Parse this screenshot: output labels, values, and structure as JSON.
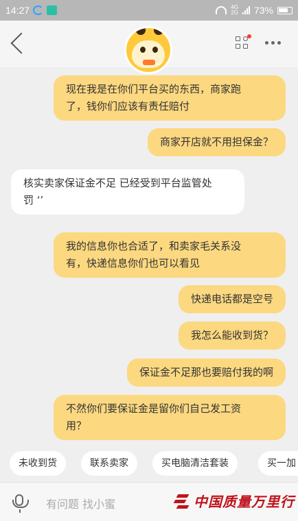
{
  "status_bar": {
    "time": "14:27",
    "network": "4G",
    "network2": "2G",
    "battery": "73%"
  },
  "header": {
    "back_icon": "chevron-left-icon",
    "avatar_icon": "bee-mascot-avatar",
    "menu_icon": "grid-menu-icon",
    "more_icon": "more-dots-icon"
  },
  "messages": [
    {
      "side": "out",
      "lines": [
        "现在我是在你们平台买的东西，商家跑",
        "了，钱你们应该有责任赔付"
      ]
    },
    {
      "side": "out",
      "lines": [
        "商家开店就不用担保金？"
      ]
    },
    {
      "side": "in",
      "lines": [
        "核实卖家保证金不足 已经受到平台监管处",
        "罚 ‘’"
      ]
    },
    {
      "side": "out",
      "lines": [
        "我的信息你也合适了，和卖家毛关系没",
        "有，快递信息你们也可以看见"
      ]
    },
    {
      "side": "out",
      "lines": [
        "快递电话都是空号"
      ]
    },
    {
      "side": "out",
      "lines": [
        "我怎么能收到货？"
      ]
    },
    {
      "side": "out",
      "lines": [
        "保证金不足那也要赔付我的啊"
      ]
    },
    {
      "side": "out",
      "lines": [
        "不然你们要保证金是留你们自己发工资",
        "用？"
      ]
    }
  ],
  "quick_replies": [
    "未收到货",
    "联系卖家",
    "买电脑清洁套装",
    "买一加"
  ],
  "input": {
    "placeholder": "有问题  找小蜜"
  },
  "watermark": {
    "text": "中国质量万里行"
  },
  "colors": {
    "outgoing_bubble": "#fcd880",
    "incoming_bubble": "#ffffff",
    "background": "#efefef",
    "watermark": "#c0121b"
  }
}
